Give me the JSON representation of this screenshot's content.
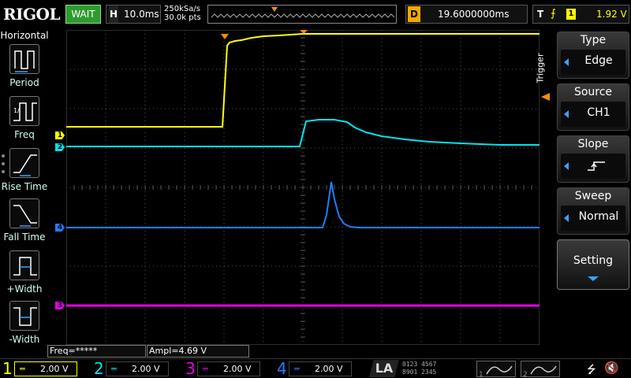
{
  "brand": "RIGOL",
  "status": "WAIT",
  "horizontal": {
    "letter": "H",
    "timebase": "10.0ms",
    "sample_rate": "250kSa/s",
    "mem_depth": "30.0k pts"
  },
  "delay": {
    "letter": "D",
    "value": "19.6000000ms"
  },
  "trigger": {
    "letter": "T",
    "edge_symbol": "⨍",
    "channel": "1",
    "level": "1.92 V"
  },
  "left_menu": {
    "title": "Horizontal",
    "items": [
      {
        "label": "Period",
        "icon": "period-icon"
      },
      {
        "label": "Freq",
        "icon": "freq-icon"
      },
      {
        "label": "Rise Time",
        "icon": "rise-time-icon"
      },
      {
        "label": "Fall Time",
        "icon": "fall-time-icon"
      },
      {
        "label": "+Width",
        "icon": "positive-width-icon"
      },
      {
        "label": "-Width",
        "icon": "negative-width-icon"
      }
    ]
  },
  "right_menu": {
    "vertical_label": "Trigger",
    "buttons": [
      {
        "head": "Type",
        "value": "Edge"
      },
      {
        "head": "Source",
        "value": "CH1"
      },
      {
        "head": "Slope",
        "value": "",
        "icon": "rising-edge-icon"
      },
      {
        "head": "Sweep",
        "value": "Normal"
      },
      {
        "head": "Setting",
        "value": ""
      }
    ]
  },
  "measurements": [
    {
      "text": "Freq=*****"
    },
    {
      "text": "Ampl=4.69 V"
    }
  ],
  "channels": [
    {
      "num": "1",
      "coupling": "═",
      "scale": "2.00 V",
      "color": "#ffff00"
    },
    {
      "num": "2",
      "coupling": "═",
      "scale": "2.00 V",
      "color": "#00e5ee"
    },
    {
      "num": "3",
      "coupling": "═",
      "scale": "2.00 V",
      "color": "#e600e6"
    },
    {
      "num": "4",
      "coupling": "═",
      "scale": "2.00 V",
      "color": "#1e7fff"
    }
  ],
  "la": {
    "label": "LA",
    "digits_row1": "0123 4567",
    "digits_row2": "8901 2345"
  },
  "ref": [
    {
      "num": "1"
    },
    {
      "num": "2"
    }
  ],
  "colors": {
    "ch1": "#ffff00",
    "ch2": "#00e5ee",
    "ch3": "#e600e6",
    "ch4": "#1e7fff",
    "trigger_marker": "#ff8c00",
    "grid": "#555555",
    "wait_badge": "#2e9b2e"
  }
}
